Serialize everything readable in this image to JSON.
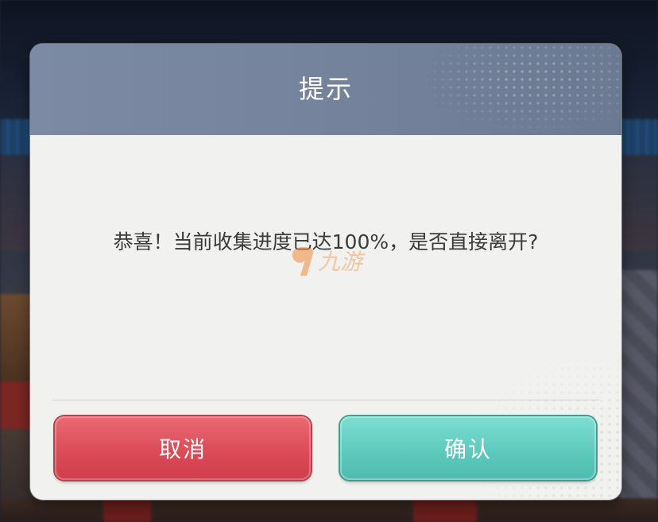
{
  "dialog": {
    "title": "提示",
    "message": "恭喜！当前收集进度已达100%，是否直接离开?",
    "watermark_text": "九游",
    "cancel_label": "取消",
    "confirm_label": "确认"
  },
  "colors": {
    "header": "#75829c",
    "body": "#f1f1ef",
    "cancel": "#dc4c58",
    "confirm": "#5ecabe",
    "message_text": "#3a3a3a"
  }
}
